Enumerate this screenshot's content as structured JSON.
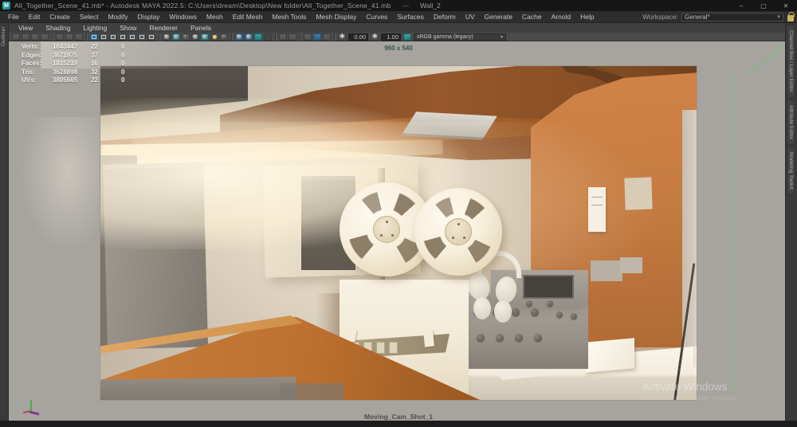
{
  "window": {
    "logo_letter": "M",
    "title": "All_Together_Scene_41.mb* - Autodesk MAYA 2022.5: C:\\Users\\dream\\Desktop\\New folder\\All_Together_Scene_41.mb",
    "title_separator": "---",
    "title_suffix": "Wall_2",
    "controls": {
      "minimize": "–",
      "maximize": "▢",
      "close": "✕"
    }
  },
  "menu_bar": {
    "items": [
      "File",
      "Edit",
      "Create",
      "Select",
      "Modify",
      "Display",
      "Windows",
      "Mesh",
      "Edit Mesh",
      "Mesh Tools",
      "Mesh Display",
      "Curves",
      "Surfaces",
      "Deform",
      "UV",
      "Generate",
      "Cache",
      "Arnold",
      "Help"
    ],
    "workspace_label": "Workspace:",
    "workspace_value": "General*",
    "workspace_caret": "▾"
  },
  "panel_menu": {
    "items": [
      "View",
      "Shading",
      "Lighting",
      "Show",
      "Renderer",
      "Panels"
    ]
  },
  "toolbar": {
    "exposure_value": "0.00",
    "gamma_value": "1.00",
    "color_space": "sRGB gamma (legacy)",
    "dropdown_caret": "▾"
  },
  "side_tabs": {
    "left": [
      "Outliner"
    ],
    "right": [
      "Channel Box / Layer Editor",
      "Attribute Editor",
      "Modeling Toolkit"
    ]
  },
  "hud": {
    "rows": [
      {
        "label": "Verts:",
        "total": "1843447",
        "selected": "22",
        "extra": "0"
      },
      {
        "label": "Edges:",
        "total": "3671975",
        "selected": "37",
        "extra": "0"
      },
      {
        "label": "Faces:",
        "total": "1815219",
        "selected": "16",
        "extra": "0"
      },
      {
        "label": "Tris:",
        "total": "3628898",
        "selected": "32",
        "extra": "0"
      },
      {
        "label": "UVs:",
        "total": "3805665",
        "selected": "22",
        "extra": "0"
      }
    ],
    "resolution": "960 x 540",
    "camera": "Moving_Cam_Shot_1"
  },
  "watermark": {
    "line1": "Activate Windows",
    "line2": "Go to Settings to activate Windows."
  },
  "colors": {
    "accent_teal": "#35c4a4",
    "active_icon_blue": "#3e7fa8",
    "active_icon_teal": "#3aa7a0",
    "gate_mask_gray": "#a7a49f",
    "wall_orange": "#c77c41",
    "resolution_text_green": "#2e5a4d"
  }
}
